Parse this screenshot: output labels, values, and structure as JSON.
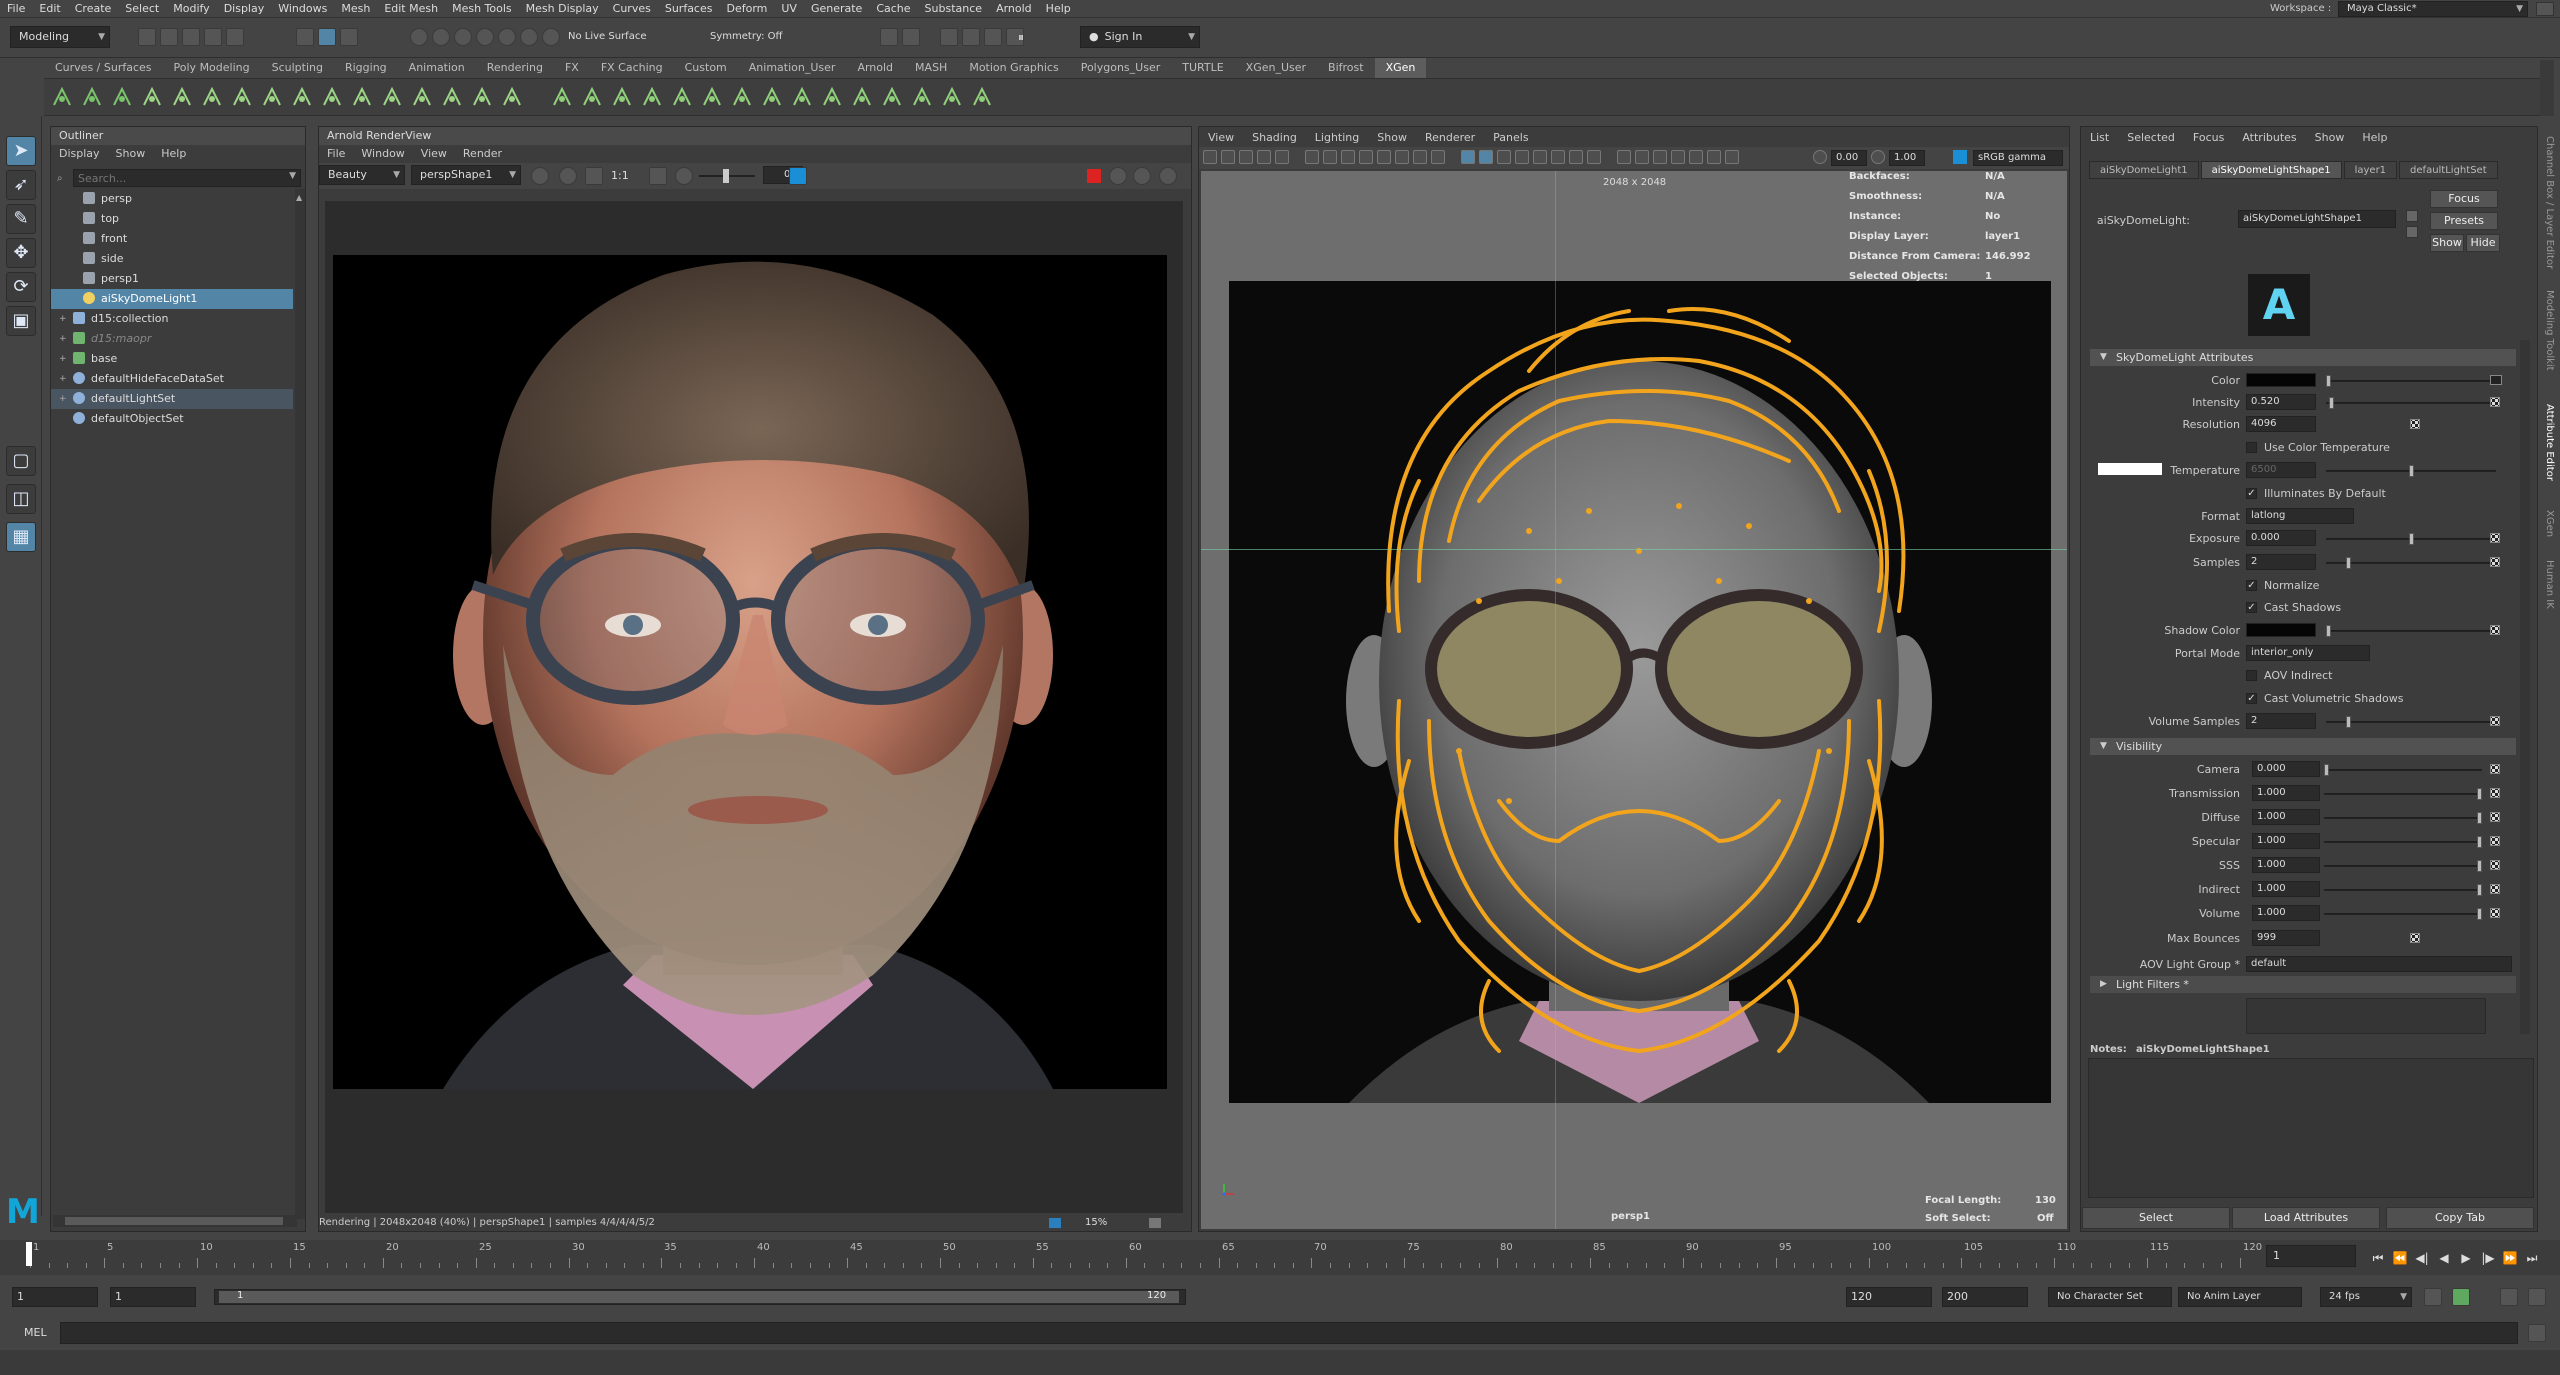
{
  "menubar": {
    "items": [
      "File",
      "Edit",
      "Create",
      "Select",
      "Modify",
      "Display",
      "Windows",
      "Mesh",
      "Edit Mesh",
      "Mesh Tools",
      "Mesh Display",
      "Curves",
      "Surfaces",
      "Deform",
      "UV",
      "Generate",
      "Cache",
      "Substance",
      "Arnold",
      "Help"
    ],
    "workspace_label": "Workspace :",
    "workspace_value": "Maya Classic*"
  },
  "statusline": {
    "mode": "Modeling",
    "live_surface": "No Live Surface",
    "symmetry": "Symmetry: Off",
    "sign_in": "Sign In"
  },
  "shelf": {
    "tabs": [
      "Curves / Surfaces",
      "Poly Modeling",
      "Sculpting",
      "Rigging",
      "Animation",
      "Rendering",
      "FX",
      "FX Caching",
      "Custom",
      "Animation_User",
      "Arnold",
      "MASH",
      "Motion Graphics",
      "Polygons_User",
      "TURTLE",
      "XGen_User",
      "Bifrost",
      "XGen"
    ],
    "active_tab": "XGen"
  },
  "outliner": {
    "title": "Outliner",
    "menu": [
      "Display",
      "Show",
      "Help"
    ],
    "search_placeholder": "Search...",
    "items": [
      {
        "label": "persp",
        "indent": 1,
        "expand": "",
        "type": "camera",
        "state": ""
      },
      {
        "label": "top",
        "indent": 1,
        "expand": "",
        "type": "camera",
        "state": ""
      },
      {
        "label": "front",
        "indent": 1,
        "expand": "",
        "type": "camera",
        "state": ""
      },
      {
        "label": "side",
        "indent": 1,
        "expand": "",
        "type": "camera",
        "state": ""
      },
      {
        "label": "persp1",
        "indent": 1,
        "expand": "",
        "type": "camera",
        "state": ""
      },
      {
        "label": "aiSkyDomeLight1",
        "indent": 1,
        "expand": "",
        "type": "light",
        "state": "sel"
      },
      {
        "label": "d15:collection",
        "indent": 0,
        "expand": "+",
        "type": "group",
        "state": ""
      },
      {
        "label": "d15:maopr",
        "indent": 0,
        "expand": "+",
        "type": "mesh",
        "state": "dim"
      },
      {
        "label": "base",
        "indent": 0,
        "expand": "+",
        "type": "mesh",
        "state": ""
      },
      {
        "label": "defaultHideFaceDataSet",
        "indent": 0,
        "expand": "+",
        "type": "set",
        "state": ""
      },
      {
        "label": "defaultLightSet",
        "indent": 0,
        "expand": "+",
        "type": "set",
        "state": "hl"
      },
      {
        "label": "defaultObjectSet",
        "indent": 0,
        "expand": "",
        "type": "set",
        "state": ""
      }
    ]
  },
  "renderview": {
    "title": "Arnold RenderView",
    "menu": [
      "File",
      "Window",
      "View",
      "Render"
    ],
    "aov": "Beauty",
    "camera": "perspShape1",
    "ratio": "1:1",
    "exposure": "0",
    "status": "Rendering | 2048x2048 (40%) | perspShape1 | samples 4/4/4/4/5/2",
    "zoom": "15%"
  },
  "viewport": {
    "menu": [
      "View",
      "Shading",
      "Lighting",
      "Show",
      "Renderer",
      "Panels"
    ],
    "exposure": "0.00",
    "gamma": "1.00",
    "colorspace": "sRGB gamma",
    "resolution_gate": "2048 x 2048",
    "hud": [
      {
        "label": "Backfaces:",
        "value": "N/A"
      },
      {
        "label": "Smoothness:",
        "value": "N/A"
      },
      {
        "label": "Instance:",
        "value": "No"
      },
      {
        "label": "Display Layer:",
        "value": "layer1"
      },
      {
        "label": "Distance From Camera:",
        "value": "146.992"
      },
      {
        "label": "Selected Objects:",
        "value": "1"
      }
    ],
    "camera_name": "persp1",
    "focal_length_label": "Focal Length:",
    "focal_length": "130",
    "soft_select_label": "Soft Select:",
    "soft_select": "Off"
  },
  "attribute_editor": {
    "menu": [
      "List",
      "Selected",
      "Focus",
      "Attributes",
      "Show",
      "Help"
    ],
    "tabs": [
      "aiSkyDomeLight1",
      "aiSkyDomeLightShape1",
      "layer1",
      "defaultLightSet"
    ],
    "active_tab": "aiSkyDomeLightShape1",
    "node_label": "aiSkyDomeLight:",
    "node_name": "aiSkyDomeLightShape1",
    "buttons": {
      "focus": "Focus",
      "presets": "Presets",
      "show": "Show",
      "hide": "Hide"
    },
    "section_attrs": "SkyDomeLight Attributes",
    "color_label": "Color",
    "color": "#050505",
    "intensity_label": "Intensity",
    "intensity": "0.520",
    "resolution_label": "Resolution",
    "resolution": "4096",
    "use_color_temp": "Use Color Temperature",
    "temperature_label": "Temperature",
    "temperature": "6500",
    "illuminates": "Illuminates By Default",
    "format_label": "Format",
    "format": "latlong",
    "exposure_label": "Exposure",
    "exposure": "0.000",
    "samples_label": "Samples",
    "samples": "2",
    "normalize": "Normalize",
    "cast_shadows": "Cast Shadows",
    "shadow_color_label": "Shadow Color",
    "shadow_color": "#050505",
    "portal_mode_label": "Portal Mode",
    "portal_mode": "interior_only",
    "aov_indirect": "AOV Indirect",
    "cast_vol_shadows": "Cast Volumetric Shadows",
    "volume_samples_label": "Volume Samples",
    "volume_samples": "2",
    "section_visibility": "Visibility",
    "visibility": [
      {
        "label": "Camera",
        "value": "0.000",
        "level": 0.0
      },
      {
        "label": "Transmission",
        "value": "1.000",
        "level": 1.0
      },
      {
        "label": "Diffuse",
        "value": "1.000",
        "level": 1.0
      },
      {
        "label": "Specular",
        "value": "1.000",
        "level": 1.0
      },
      {
        "label": "SSS",
        "value": "1.000",
        "level": 1.0
      },
      {
        "label": "Indirect",
        "value": "1.000",
        "level": 1.0
      },
      {
        "label": "Volume",
        "value": "1.000",
        "level": 1.0
      }
    ],
    "max_bounces_label": "Max Bounces",
    "max_bounces": "999",
    "aov_light_group_label": "AOV Light Group *",
    "aov_light_group": "default",
    "section_filters": "Light Filters *",
    "notes_label": "Notes:",
    "notes_node": "aiSkyDomeLightShape1",
    "bottom_buttons": [
      "Select",
      "Load Attributes",
      "Copy Tab"
    ],
    "side_tabs": [
      "Channel Box / Layer Editor",
      "Modeling Toolkit",
      "Attribute Editor",
      "XGen",
      "Human IK"
    ]
  },
  "timeline": {
    "ticks": [
      "1",
      "5",
      "10",
      "15",
      "20",
      "25",
      "30",
      "35",
      "40",
      "45",
      "50",
      "55",
      "60",
      "65",
      "70",
      "75",
      "80",
      "85",
      "90",
      "95",
      "100",
      "105",
      "110",
      "115",
      "120"
    ],
    "current_frame": "1"
  },
  "range": {
    "start": "1",
    "playback_start": "1",
    "slider_start": "1",
    "slider_end": "120",
    "playback_end": "120",
    "end": "200",
    "character_set": "No Character Set",
    "anim_layer": "No Anim Layer",
    "fps": "24 fps"
  },
  "command": {
    "lang": "MEL"
  }
}
